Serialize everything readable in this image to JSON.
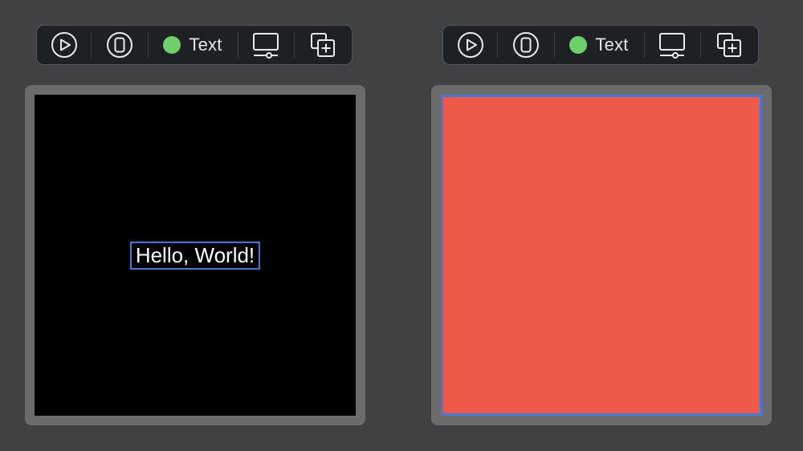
{
  "colors": {
    "background": "#414141",
    "toolbar_bg": "#1f2024",
    "frame": "#6b6b6b",
    "selection_outline": "#4a76d4",
    "status_green": "#6fcf6a",
    "red_fill": "#ef5a48"
  },
  "previews": [
    {
      "toolbar": {
        "play_icon": "play-circle-icon",
        "device_icon": "device-settings-icon",
        "mode_label": "Text",
        "status_color": "#6fcf6a",
        "display_icon": "display-settings-icon",
        "duplicate_icon": "duplicate-preview-icon"
      },
      "screen": {
        "background": "#000000",
        "text": "Hello, World!"
      }
    },
    {
      "toolbar": {
        "play_icon": "play-circle-icon",
        "device_icon": "device-settings-icon",
        "mode_label": "Text",
        "status_color": "#6fcf6a",
        "display_icon": "display-settings-icon",
        "duplicate_icon": "duplicate-preview-icon"
      },
      "screen": {
        "background": "#ef5a48"
      }
    }
  ]
}
